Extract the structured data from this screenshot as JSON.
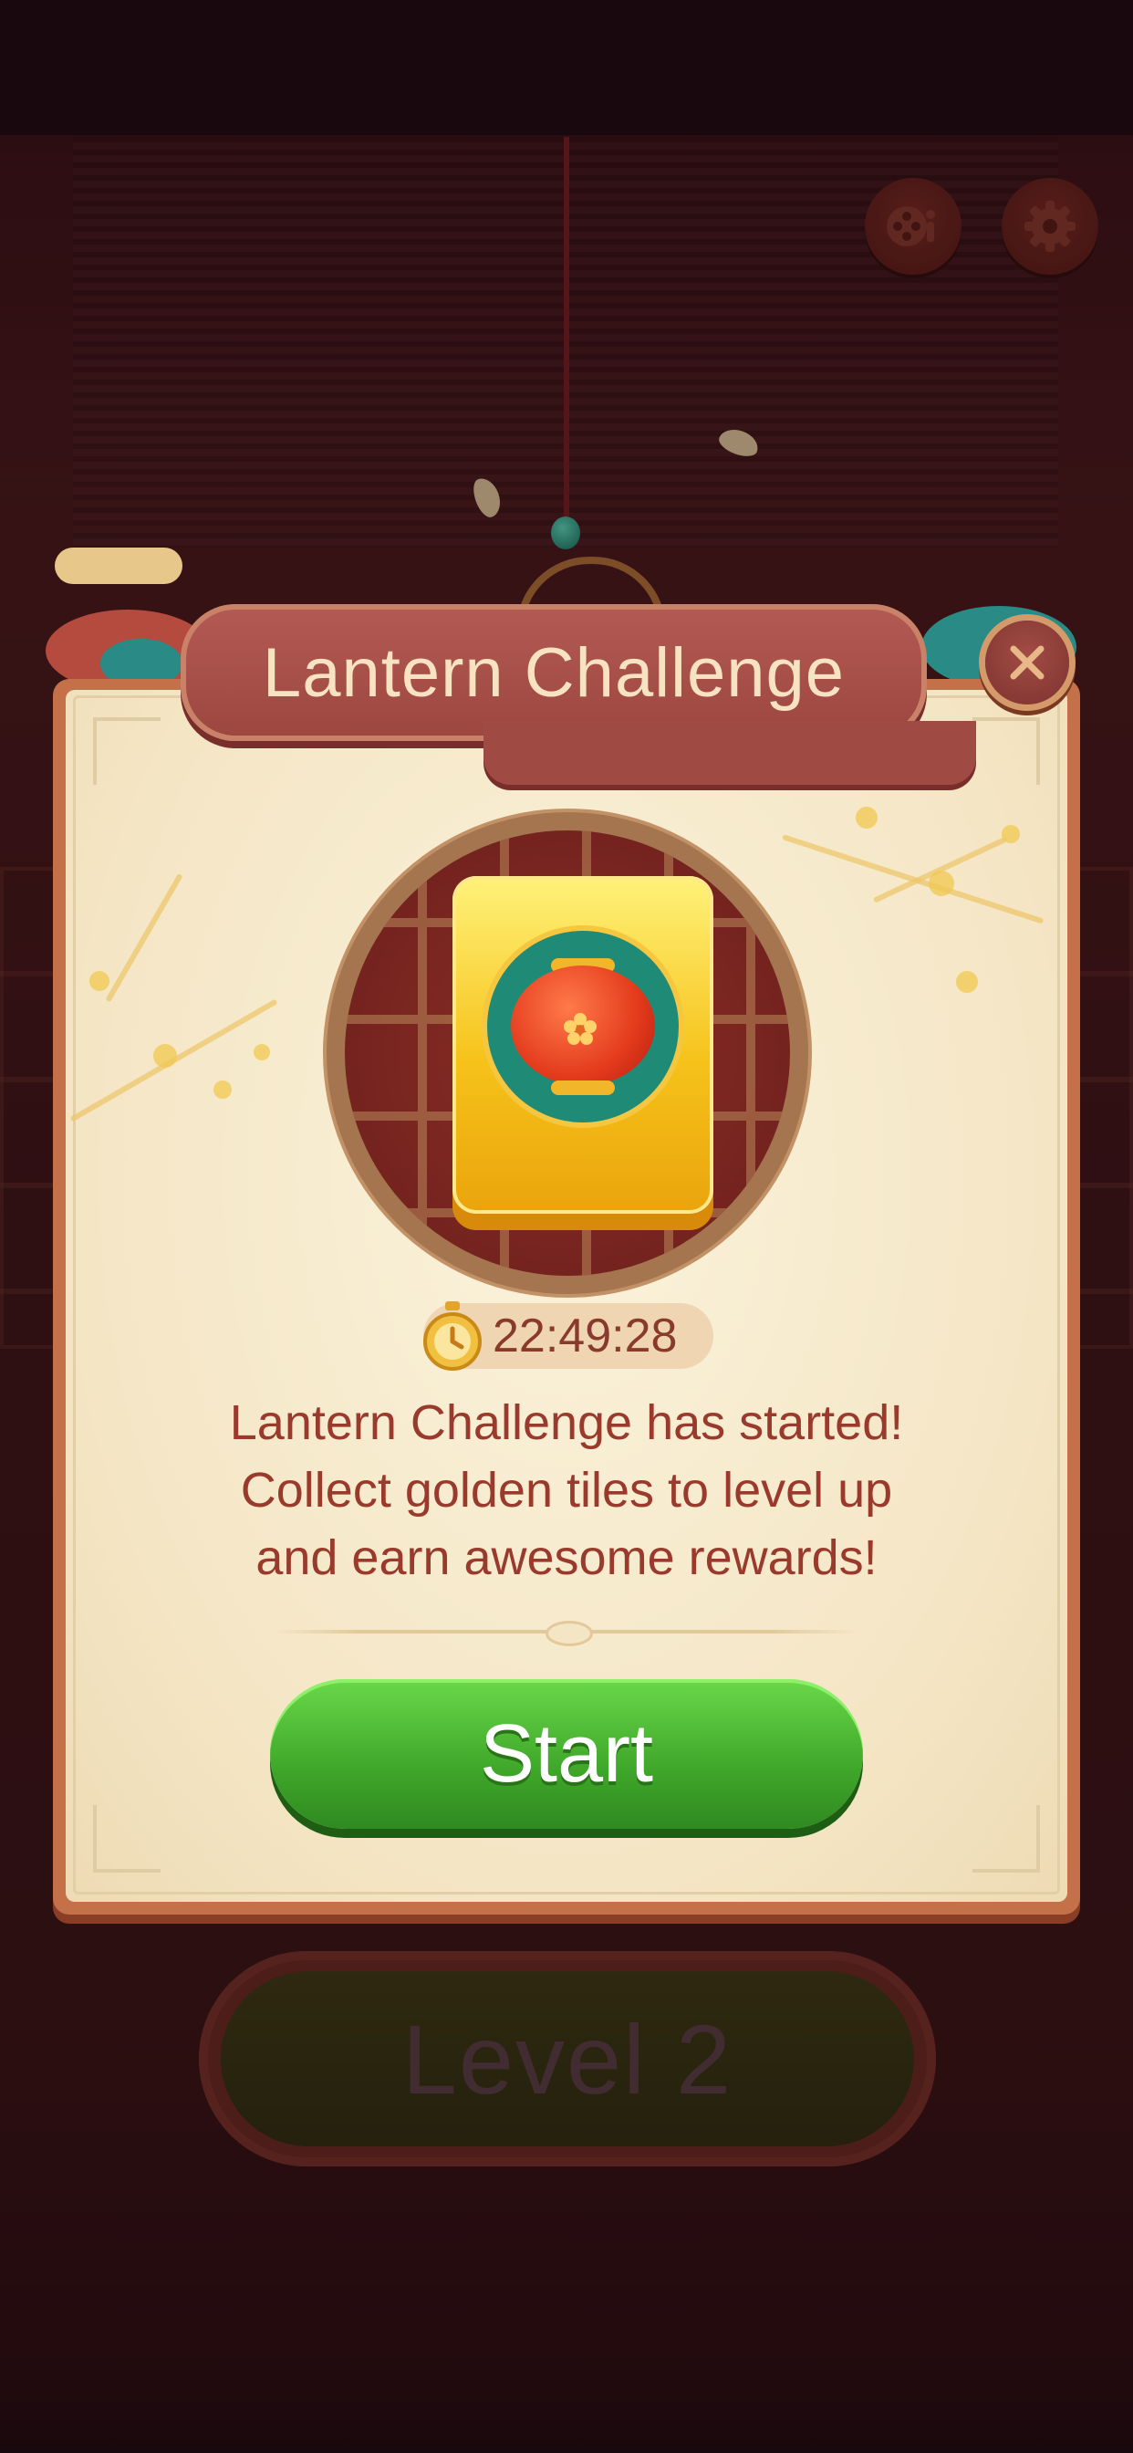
{
  "title": "Lantern Challenge",
  "timer": "22:49:28",
  "description": {
    "line1": "Lantern Challenge has started!",
    "line2": "Collect golden tiles to level up",
    "line3": "and earn awesome rewards!"
  },
  "start_label": "Start",
  "level_label": "Level 2",
  "icons": {
    "top_left": "film-reel-icon",
    "top_right": "gear-icon",
    "close": "close-icon",
    "timer": "stopwatch-icon",
    "reward": "lantern-tile-icon"
  },
  "colors": {
    "banner": "#9c4640",
    "start_button": "#3fa72a",
    "panel": "#f4e5c4",
    "text": "#9a3a2c"
  }
}
